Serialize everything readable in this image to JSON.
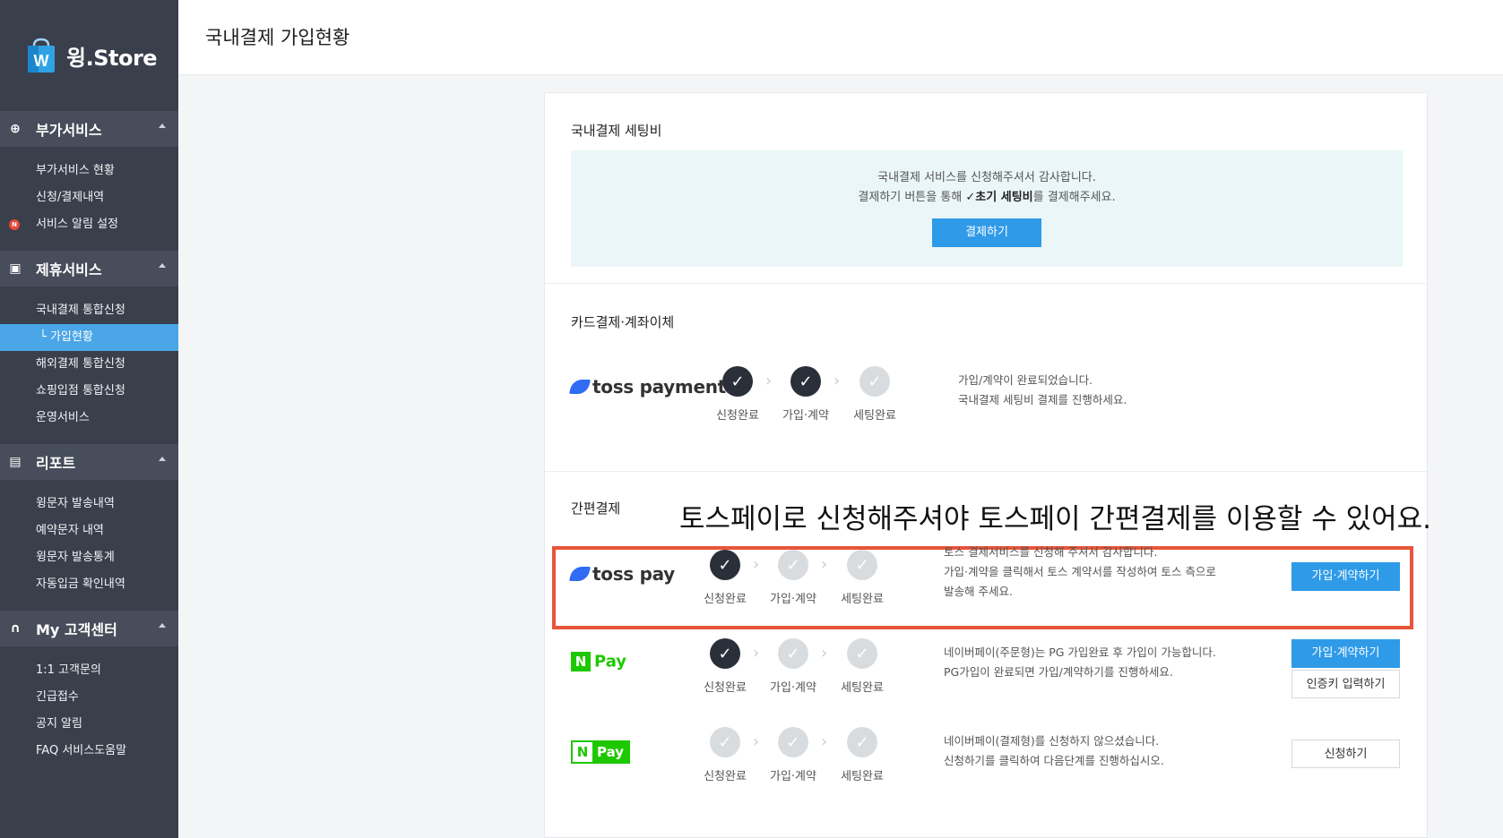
{
  "sidebar": {
    "logo_text": "윙.Store",
    "logo_mark": "W",
    "sections": [
      {
        "title": "부가서비스",
        "icon": "plus-circle-icon",
        "items": [
          {
            "label": "부가서비스 현황"
          },
          {
            "label": "신청/결제내역"
          },
          {
            "label": "서비스 알림 설정",
            "badge": "N"
          }
        ]
      },
      {
        "title": "제휴서비스",
        "icon": "calendar-icon",
        "items": [
          {
            "label": "국내결제 통합신청"
          },
          {
            "label": "└ 가입현황",
            "active": true
          },
          {
            "label": "해외결제 통합신청"
          },
          {
            "label": "쇼핑입점 통합신청"
          },
          {
            "label": "운영서비스"
          }
        ]
      },
      {
        "title": "리포트",
        "icon": "report-icon",
        "items": [
          {
            "label": "윙문자 발송내역"
          },
          {
            "label": "예약문자 내역"
          },
          {
            "label": "윙문자 발송통계"
          },
          {
            "label": "자동입금 확인내역"
          }
        ]
      },
      {
        "title": "My 고객센터",
        "icon": "headset-icon",
        "items": [
          {
            "label": "1:1 고객문의"
          },
          {
            "label": "긴급접수"
          },
          {
            "label": "공지 알림"
          },
          {
            "label": "FAQ 서비스도움말"
          }
        ]
      }
    ]
  },
  "header": {
    "title": "국내결제 가입현황"
  },
  "setting_fee": {
    "title": "국내결제 세팅비",
    "line1": "국내결제 서비스를 신청해주셔서 감사합니다.",
    "line2_prefix": "결제하기 버튼을 통해 ",
    "line2_bold": "✓초기 세팅비",
    "line2_suffix": "를 결제해주세요.",
    "button": "결제하기"
  },
  "card_section": {
    "title": "카드결제·계좌이체"
  },
  "easy_section": {
    "title": "간편결제"
  },
  "callout": "토스페이로 신청해주셔야 토스페이 간편결제를 이용할 수 있어요.",
  "step_labels": [
    "신청완료",
    "가입·계약",
    "세팅완료"
  ],
  "check_glyph": "✓",
  "chevron_glyph": "›",
  "providers": [
    {
      "name": "toss payments",
      "logo_color": "#2f6cf3",
      "steps": [
        true,
        true,
        false
      ],
      "desc": [
        "가입/계약이 완료되었습니다.",
        "국내결제 세팅비 결제를 진행하세요."
      ]
    },
    {
      "name": "toss pay",
      "logo_color": "#2f6cf3",
      "steps": [
        true,
        false,
        false
      ],
      "desc": [
        "토스 결제서비스를 신청해 주셔서 감사합니다.",
        "가입·계약을 클릭해서 토스 계약서를 작성하여 토스 측으로",
        "발송해 주세요."
      ],
      "buttons": [
        {
          "label": "가입·계약하기",
          "style": "primary"
        }
      ]
    },
    {
      "name": "Pay",
      "mark": "N",
      "logo_color": "#1ec800",
      "steps": [
        true,
        false,
        false
      ],
      "desc": [
        "네이버페이(주문형)는 PG 가입완료 후 가입이 가능합니다.",
        "PG가입이 완료되면 가입/계약하기를 진행하세요."
      ],
      "buttons": [
        {
          "label": "가입·계약하기",
          "style": "primary"
        },
        {
          "label": "인증키 입력하기",
          "style": "outline"
        }
      ]
    },
    {
      "name": "Pay",
      "mark": "N",
      "logo_color": "#1ec800",
      "steps": [
        false,
        false,
        false
      ],
      "desc": [
        "네이버페이(결제형)를 신청하지 않으셨습니다.",
        "신청하기를 클릭하여 다음단계를 진행하십시오."
      ],
      "buttons": [
        {
          "label": "신청하기",
          "style": "outline"
        }
      ]
    }
  ]
}
